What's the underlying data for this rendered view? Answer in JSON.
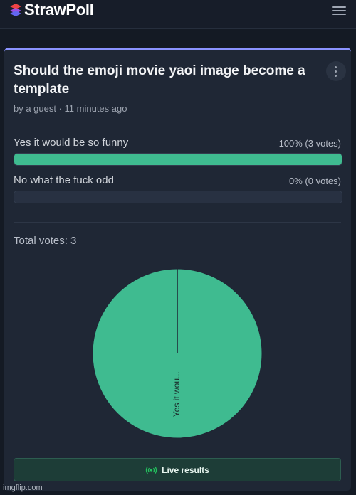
{
  "header": {
    "logo_text": "StrawPoll",
    "logo_colors": [
      "#ef4444",
      "#6366f1"
    ],
    "menu_icon": "hamburger-menu-icon"
  },
  "poll": {
    "title": "Should the emoji movie yaoi image become a template",
    "meta": "by a guest · 11 minutes ago",
    "options": [
      {
        "label": "Yes it would be so funny",
        "result": "100% (3 votes)",
        "fraction": 1.0
      },
      {
        "label": "No what the fuck odd",
        "result": "0% (0 votes)",
        "fraction": 0.0
      }
    ],
    "total_votes": "Total votes: 3",
    "live_results_label": "Live results"
  },
  "chart_data": {
    "type": "pie",
    "labels": [
      "Yes it wou...",
      "No what the fuck odd"
    ],
    "values": [
      3,
      0
    ],
    "colors": [
      "#3fbb90",
      "#6366f1"
    ]
  },
  "colors": {
    "accent": "#8b93ff",
    "bar_fill": "#3fbb90",
    "live_indicator": "#22c55e"
  },
  "watermark": "imgflip.com"
}
